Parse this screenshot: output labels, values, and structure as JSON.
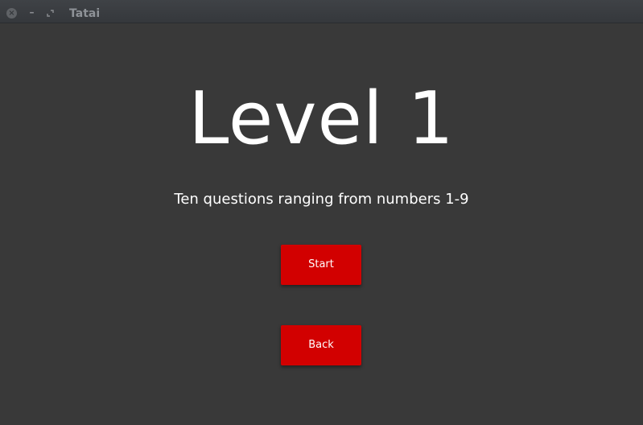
{
  "window": {
    "title": "Tatai",
    "close_glyph": "×",
    "minimize_glyph": "–"
  },
  "main": {
    "heading": "Level 1",
    "subtitle": "Ten questions ranging from numbers 1-9",
    "start_label": "Start",
    "back_label": "Back"
  },
  "colors": {
    "background": "#393939",
    "button": "#d20000",
    "text": "#ffffff",
    "titlebar": "#3b3e42"
  },
  "icons": {
    "close": "close-icon",
    "minimize": "minimize-icon",
    "maximize": "maximize-icon"
  }
}
